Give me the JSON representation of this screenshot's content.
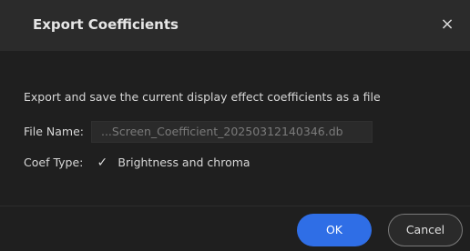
{
  "dialog": {
    "title": "Export Coefficients",
    "close_icon": "close-icon",
    "close_glyph": "×"
  },
  "body": {
    "description": "Export and save the current display effect coefficients as a file",
    "file_name_label": "File Name:",
    "file_name_value": "...Screen_Coefficient_20250312140346.db",
    "coef_type_label": "Coef Type:",
    "coef_checkbox_checked": true,
    "coef_checkbox_glyph": "✓",
    "coef_option_label": "Brightness and chroma"
  },
  "footer": {
    "ok_label": "OK",
    "cancel_label": "Cancel"
  },
  "colors": {
    "primary": "#2f6ee6",
    "background": "#1f1f1f",
    "titlebar": "#2b2b2b",
    "text": "#d7d7d7"
  }
}
